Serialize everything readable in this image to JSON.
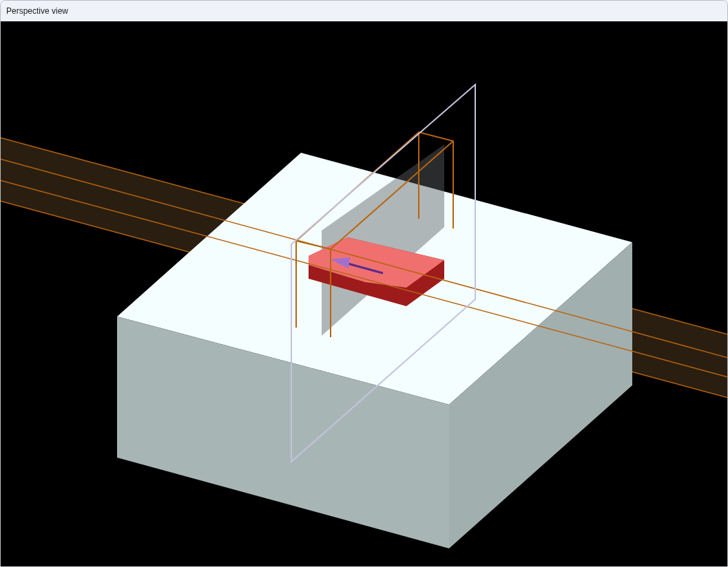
{
  "window": {
    "title": "Perspective view"
  }
}
